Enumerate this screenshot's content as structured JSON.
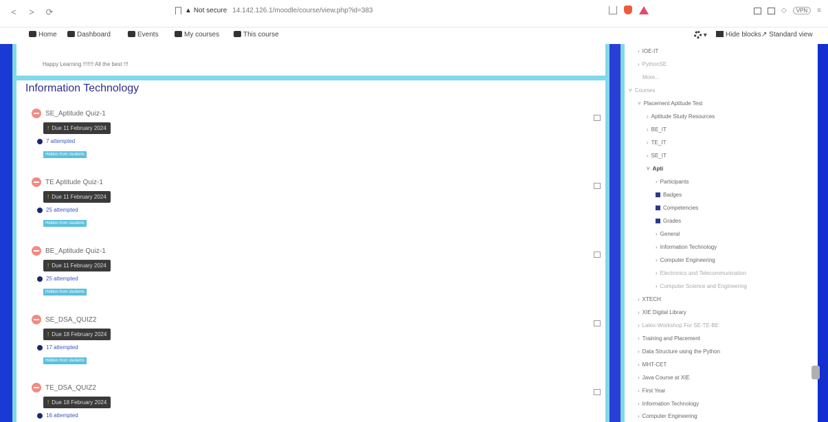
{
  "browser": {
    "back": "<",
    "forward": ">",
    "reload": "⟳",
    "security": "Not secure",
    "url": "14.142.126.1/moodle/course/view.php?id=383",
    "vpn": "VPN",
    "menu": "≡"
  },
  "nav": {
    "home": "Home",
    "dashboard": "Dashboard",
    "events": "Events",
    "my_courses": "My courses",
    "this_course": "This course",
    "hide_blocks": "Hide blocks",
    "standard_view": "Standard view"
  },
  "main": {
    "happy_text": "Happy Learning !!!!!!! All the best !!!",
    "section_title": "Information Technology",
    "activities": [
      {
        "name": "SE_Aptitude Quiz-1",
        "due": "Due 11 February 2024",
        "attempted": "7 attempted",
        "badge": "Hidden from students"
      },
      {
        "name": "TE Aptitude Quiz-1",
        "due": "Due 11 February 2024",
        "attempted": "25 attempted",
        "badge": "Hidden from students"
      },
      {
        "name": "BE_Aptitude Quiz-1",
        "due": "Due 11 February 2024",
        "attempted": "25 attempted",
        "badge": "Hidden from students"
      },
      {
        "name": "SE_DSA_QUIZ2",
        "due": "Due 18 February 2024",
        "attempted": "17 attempted",
        "badge": "Hidden from students"
      },
      {
        "name": "TE_DSA_QUIZ2",
        "due": "Due 18 February 2024",
        "attempted": "16 attempted",
        "badge": ""
      }
    ]
  },
  "sidebar": {
    "items": [
      {
        "label": "IOE-IT",
        "arrow": "›"
      },
      {
        "label": "PythonSE",
        "arrow": "›"
      },
      {
        "label": "More...",
        "arrow": ""
      },
      {
        "label": "Courses",
        "arrow": "˅"
      },
      {
        "label": "Placement Aptitude Test",
        "arrow": "˅"
      },
      {
        "label": "Aptitude Study Resources",
        "arrow": "›"
      },
      {
        "label": "BE_IT",
        "arrow": "›"
      },
      {
        "label": "TE_IT",
        "arrow": "›"
      },
      {
        "label": "SE_IT",
        "arrow": "›"
      },
      {
        "label": "Apti",
        "arrow": "˅"
      },
      {
        "label": "Participants",
        "arrow": "›"
      },
      {
        "label": "Badges",
        "arrow": ""
      },
      {
        "label": "Competencies",
        "arrow": ""
      },
      {
        "label": "Grades",
        "arrow": ""
      },
      {
        "label": "General",
        "arrow": "›"
      },
      {
        "label": "Information Technology",
        "arrow": "›"
      },
      {
        "label": "Computer Engineering",
        "arrow": "›"
      },
      {
        "label": "Electronics and Telecommunication",
        "arrow": "›"
      },
      {
        "label": "Computer Science and Engineering",
        "arrow": "›"
      },
      {
        "label": "XTECH",
        "arrow": "›"
      },
      {
        "label": "XIE Digital Library",
        "arrow": "›"
      },
      {
        "label": "Latex-Workshop For SE-TE-BE",
        "arrow": "›"
      },
      {
        "label": "Training and Placement",
        "arrow": "›"
      },
      {
        "label": "Data Structure using the Python",
        "arrow": "›"
      },
      {
        "label": "MHT-CET",
        "arrow": "›"
      },
      {
        "label": "Java Course at XIE",
        "arrow": "›"
      },
      {
        "label": "First Year",
        "arrow": "›"
      },
      {
        "label": "Information Technology",
        "arrow": "›"
      },
      {
        "label": "Computer Engineering",
        "arrow": "›"
      }
    ]
  }
}
